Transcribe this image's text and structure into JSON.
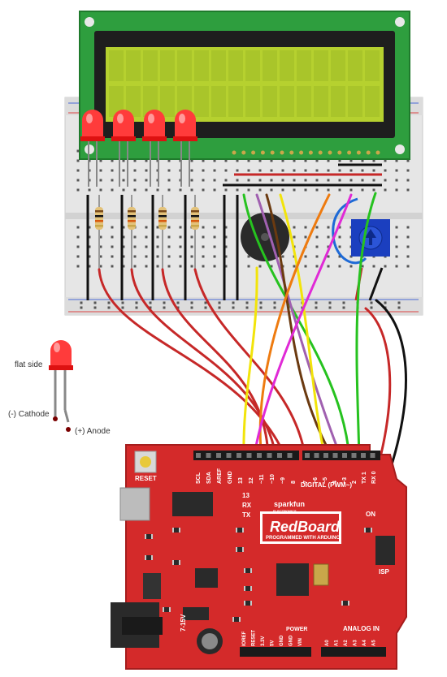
{
  "led_legend": {
    "flat_side": "flat side",
    "cathode": "(-) Cathode",
    "anode": "(+) Anode"
  },
  "board": {
    "brand": "sparkfun",
    "brand_sub": "ELECTRONICS",
    "name": "RedBoard",
    "tagline": "PROGRAMMED WITH ARDUINO",
    "reset_label": "RESET",
    "digital_label": "DIGITAL (PWM~)",
    "power_label": "POWER",
    "analog_label": "ANALOG IN",
    "on_label": "ON",
    "isp_label": "ISP",
    "vin_label": "7-15V",
    "led13": "13",
    "rx": "RX",
    "tx": "TX",
    "top_pins": [
      "SCL",
      "SDA",
      "AREF",
      "GND",
      "13",
      "12",
      "~11",
      "~10",
      "~9",
      "8",
      "7",
      "~6",
      "~5",
      "4",
      "~3",
      "2",
      "TX 1",
      "RX 0"
    ],
    "power_pins": [
      "IOREF",
      "RESET",
      "3.3V",
      "5V",
      "GND",
      "GND",
      "VIN"
    ],
    "analog_pins": [
      "A0",
      "A1",
      "A2",
      "A3",
      "A4",
      "A5"
    ]
  },
  "colors": {
    "board_red": "#d42a2a",
    "lcd_green": "#b6d12f",
    "lcd_frame": "#2e9e3e",
    "breadboard": "#e8e8e8"
  }
}
